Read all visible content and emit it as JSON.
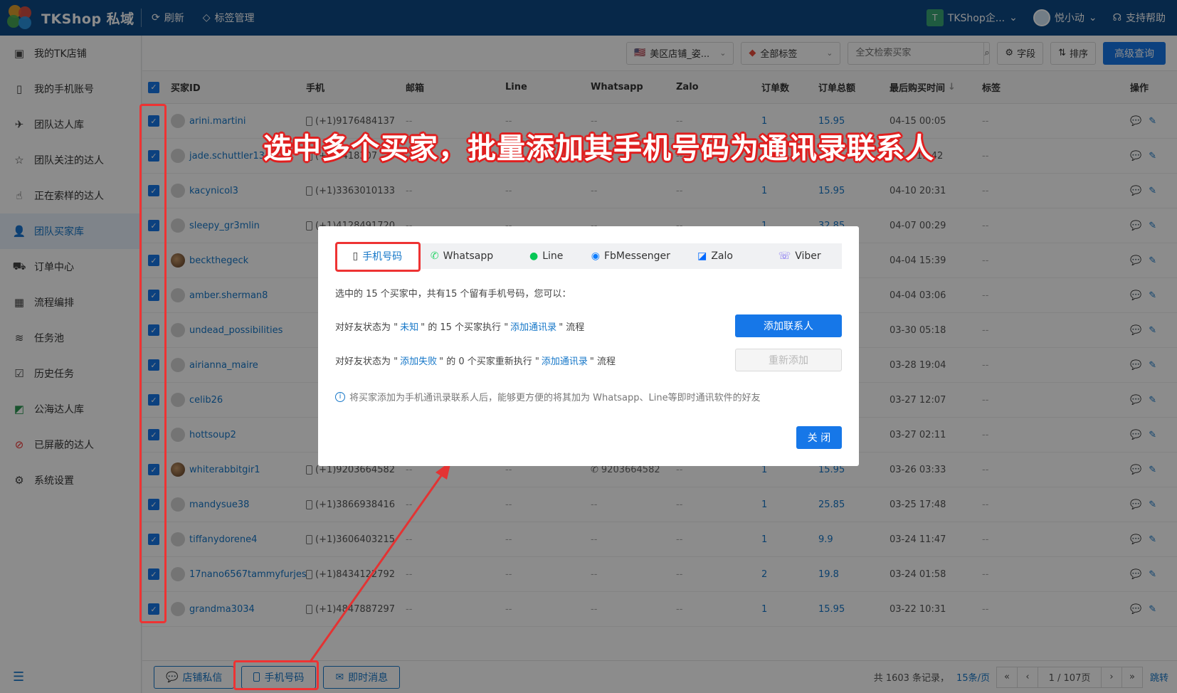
{
  "app": {
    "title": "TKShop 私域",
    "refresh": "刷新",
    "tag_manage": "标签管理",
    "org": "TKShop企...",
    "org_initial": "T",
    "user": "悦小动",
    "help": "支持帮助"
  },
  "sidebar": {
    "items": [
      {
        "label": "我的TK店铺",
        "icon": "shop-icon"
      },
      {
        "label": "我的手机账号",
        "icon": "phone-icon"
      },
      {
        "label": "团队达人库",
        "icon": "creator-icon"
      },
      {
        "label": "团队关注的达人",
        "icon": "star-icon"
      },
      {
        "label": "正在索样的达人",
        "icon": "hand-icon"
      },
      {
        "label": "团队买家库",
        "icon": "user-icon"
      },
      {
        "label": "订单中心",
        "icon": "truck-icon"
      },
      {
        "label": "流程编排",
        "icon": "calendar-icon"
      },
      {
        "label": "任务池",
        "icon": "layers-icon"
      },
      {
        "label": "历史任务",
        "icon": "clipboard-icon"
      },
      {
        "label": "公海达人库",
        "icon": "public-icon"
      },
      {
        "label": "已屏蔽的达人",
        "icon": "block-icon"
      },
      {
        "label": "系统设置",
        "icon": "gear-icon"
      }
    ],
    "active_index": 5
  },
  "toolbar": {
    "shop_select": "美区店铺_姿...",
    "tag_select": "全部标签",
    "search_placeholder": "全文检索买家",
    "fields": "字段",
    "sort": "排序",
    "advanced": "高级查询"
  },
  "table": {
    "headers": {
      "buyer_id": "买家ID",
      "phone": "手机",
      "email": "邮箱",
      "line": "Line",
      "whatsapp": "Whatsapp",
      "zalo": "Zalo",
      "orders": "订单数",
      "total": "订单总额",
      "last": "最后购买时间",
      "tags": "标签",
      "ops": "操作"
    },
    "rows": [
      {
        "id": "arini.martini",
        "phone": "(+1)9176484137",
        "orders": "1",
        "total": "15.95",
        "last": "04-15 00:05",
        "photo": false
      },
      {
        "id": "jade.schuttler13",
        "phone": "(+1)6418307",
        "orders": "",
        "total": "",
        "last": "04-... 11:42",
        "photo": false
      },
      {
        "id": "kacynicol3",
        "phone": "(+1)3363010133",
        "orders": "1",
        "total": "15.95",
        "last": "04-10 20:31",
        "photo": false
      },
      {
        "id": "sleepy_gr3mlin",
        "phone": "(+1)4128491720",
        "orders": "1",
        "total": "32.85",
        "last": "04-07 00:29",
        "photo": false
      },
      {
        "id": "beckthegeck",
        "phone": "",
        "orders": "",
        "total": "",
        "last": "04-04 15:39",
        "photo": true
      },
      {
        "id": "amber.sherman8",
        "phone": "",
        "orders": "",
        "total": "",
        "last": "04-04 03:06",
        "photo": false
      },
      {
        "id": "undead_possibilities",
        "phone": "",
        "orders": "",
        "total": "",
        "last": "03-30 05:18",
        "photo": false
      },
      {
        "id": "airianna_maire",
        "phone": "",
        "orders": "",
        "total": "",
        "last": "03-28 19:04",
        "photo": false
      },
      {
        "id": "celib26",
        "phone": "",
        "orders": "",
        "total": "",
        "last": "03-27 12:07",
        "photo": false
      },
      {
        "id": "hottsoup2",
        "phone": "",
        "orders": "",
        "total": "",
        "last": "03-27 02:11",
        "photo": false
      },
      {
        "id": "whiterabbitgir1",
        "phone": "(+1)9203664582",
        "whatsapp": "9203664582",
        "orders": "1",
        "total": "15.95",
        "last": "03-26 03:33",
        "photo": true
      },
      {
        "id": "mandysue38",
        "phone": "(+1)3866938416",
        "orders": "1",
        "total": "25.85",
        "last": "03-25 17:48",
        "photo": false
      },
      {
        "id": "tiffanydorene4",
        "phone": "(+1)3606403215",
        "orders": "1",
        "total": "9.9",
        "last": "03-24 11:47",
        "photo": false
      },
      {
        "id": "17nano6567tammyfurjes",
        "phone": "(+1)8434122792",
        "orders": "2",
        "total": "19.8",
        "last": "03-24 01:58",
        "photo": false
      },
      {
        "id": "grandma3034",
        "phone": "(+1)4847887297",
        "orders": "1",
        "total": "15.95",
        "last": "03-22 10:31",
        "photo": false
      }
    ]
  },
  "footer": {
    "shop_msg": "店铺私信",
    "phone": "手机号码",
    "im": "即时消息",
    "total": "共 1603 条记录，",
    "per_page": "15条/页",
    "page": "1 / 107页",
    "jump": "跳转"
  },
  "modal": {
    "tabs": [
      "手机号码",
      "Whatsapp",
      "Line",
      "FbMessenger",
      "Zalo",
      "Viber"
    ],
    "desc": "选中的 15 个买家中，共有15 个留有手机号码，您可以：",
    "row1_a": "对好友状态为 \"",
    "row1_status": "未知",
    "row1_b": "\" 的 15 个买家执行 \"",
    "row1_flow": "添加通讯录",
    "row1_c": "\" 流程",
    "row2_a": "对好友状态为 \"",
    "row2_status": "添加失败",
    "row2_b": "\" 的 0 个买家重新执行 \"",
    "row2_flow": "添加通讯录",
    "row2_c": "\" 流程",
    "add_btn": "添加联系人",
    "re_btn": "重新添加",
    "tip": "将买家添加为手机通讯录联系人后，能够更方便的将其加为 Whatsapp、Line等即时通讯软件的好友",
    "close": "关 闭"
  },
  "annotation": {
    "text": "选中多个买家，批量添加其手机号码为通讯录联系人"
  },
  "colors": {
    "topbar": "#0e4a86",
    "primary": "#1677e8",
    "annotation_red": "#e33333"
  }
}
